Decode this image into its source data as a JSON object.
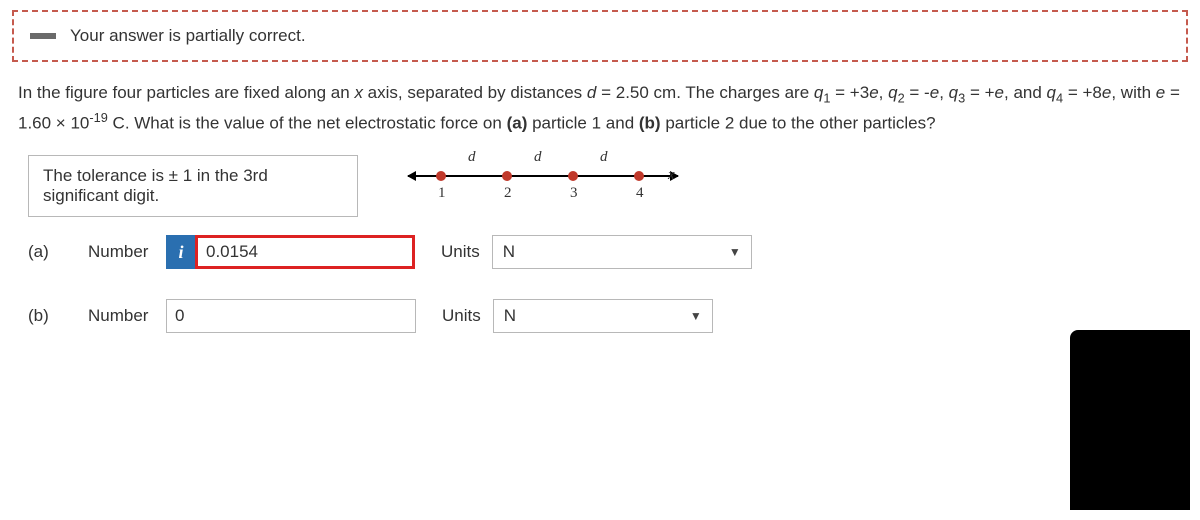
{
  "banner": {
    "message": "Your answer is partially correct."
  },
  "question": {
    "line1_pre": "In the figure four particles are fixed along an ",
    "xaxis": "x",
    "line1_mid": " axis, separated by distances ",
    "dvar": "d",
    "dval": " = 2.50 cm. The charges are ",
    "q": "q",
    "s1": "1",
    "eq1": " = +3",
    "evar": "e",
    "c1": ", ",
    "s2": "2",
    "eq2": " = -",
    "s3": "3",
    "eq3": " = +",
    "and": ", and ",
    "s4": "4",
    "line2a": " = +8",
    "line2b": ", with ",
    "eeq": " = 1.60 × 10",
    "exp": "-19",
    "line2c": " C. What is the value of the net electrostatic force on ",
    "pa": "(a)",
    "line2d": " particle 1 and ",
    "pb": "(b)",
    "line2e": " particle 2 due to the other particles?"
  },
  "tolerance": "The tolerance is ± 1 in the 3rd significant digit.",
  "diagram": {
    "p1": "1",
    "p2": "2",
    "p3": "3",
    "p4": "4",
    "d": "d",
    "x": "x"
  },
  "parts": {
    "a": {
      "tag": "(a)",
      "label": "Number",
      "info": "i",
      "value": "0.0154",
      "units_label": "Units",
      "units_value": "N"
    },
    "b": {
      "tag": "(b)",
      "label": "Number",
      "value": "0",
      "units_label": "Units",
      "units_value": "N"
    }
  }
}
